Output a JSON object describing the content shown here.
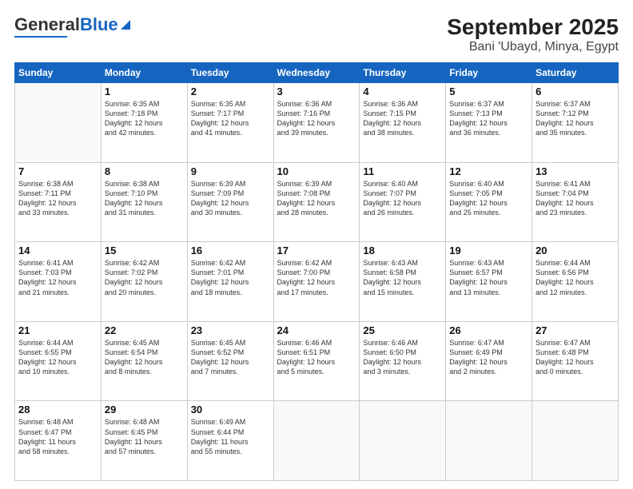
{
  "header": {
    "logo_general": "General",
    "logo_blue": "Blue",
    "month": "September 2025",
    "location": "Bani 'Ubayd, Minya, Egypt"
  },
  "days_of_week": [
    "Sunday",
    "Monday",
    "Tuesday",
    "Wednesday",
    "Thursday",
    "Friday",
    "Saturday"
  ],
  "weeks": [
    [
      {
        "day": "",
        "content": ""
      },
      {
        "day": "1",
        "content": "Sunrise: 6:35 AM\nSunset: 7:18 PM\nDaylight: 12 hours\nand 42 minutes."
      },
      {
        "day": "2",
        "content": "Sunrise: 6:35 AM\nSunset: 7:17 PM\nDaylight: 12 hours\nand 41 minutes."
      },
      {
        "day": "3",
        "content": "Sunrise: 6:36 AM\nSunset: 7:16 PM\nDaylight: 12 hours\nand 39 minutes."
      },
      {
        "day": "4",
        "content": "Sunrise: 6:36 AM\nSunset: 7:15 PM\nDaylight: 12 hours\nand 38 minutes."
      },
      {
        "day": "5",
        "content": "Sunrise: 6:37 AM\nSunset: 7:13 PM\nDaylight: 12 hours\nand 36 minutes."
      },
      {
        "day": "6",
        "content": "Sunrise: 6:37 AM\nSunset: 7:12 PM\nDaylight: 12 hours\nand 35 minutes."
      }
    ],
    [
      {
        "day": "7",
        "content": "Sunrise: 6:38 AM\nSunset: 7:11 PM\nDaylight: 12 hours\nand 33 minutes."
      },
      {
        "day": "8",
        "content": "Sunrise: 6:38 AM\nSunset: 7:10 PM\nDaylight: 12 hours\nand 31 minutes."
      },
      {
        "day": "9",
        "content": "Sunrise: 6:39 AM\nSunset: 7:09 PM\nDaylight: 12 hours\nand 30 minutes."
      },
      {
        "day": "10",
        "content": "Sunrise: 6:39 AM\nSunset: 7:08 PM\nDaylight: 12 hours\nand 28 minutes."
      },
      {
        "day": "11",
        "content": "Sunrise: 6:40 AM\nSunset: 7:07 PM\nDaylight: 12 hours\nand 26 minutes."
      },
      {
        "day": "12",
        "content": "Sunrise: 6:40 AM\nSunset: 7:05 PM\nDaylight: 12 hours\nand 25 minutes."
      },
      {
        "day": "13",
        "content": "Sunrise: 6:41 AM\nSunset: 7:04 PM\nDaylight: 12 hours\nand 23 minutes."
      }
    ],
    [
      {
        "day": "14",
        "content": "Sunrise: 6:41 AM\nSunset: 7:03 PM\nDaylight: 12 hours\nand 21 minutes."
      },
      {
        "day": "15",
        "content": "Sunrise: 6:42 AM\nSunset: 7:02 PM\nDaylight: 12 hours\nand 20 minutes."
      },
      {
        "day": "16",
        "content": "Sunrise: 6:42 AM\nSunset: 7:01 PM\nDaylight: 12 hours\nand 18 minutes."
      },
      {
        "day": "17",
        "content": "Sunrise: 6:42 AM\nSunset: 7:00 PM\nDaylight: 12 hours\nand 17 minutes."
      },
      {
        "day": "18",
        "content": "Sunrise: 6:43 AM\nSunset: 6:58 PM\nDaylight: 12 hours\nand 15 minutes."
      },
      {
        "day": "19",
        "content": "Sunrise: 6:43 AM\nSunset: 6:57 PM\nDaylight: 12 hours\nand 13 minutes."
      },
      {
        "day": "20",
        "content": "Sunrise: 6:44 AM\nSunset: 6:56 PM\nDaylight: 12 hours\nand 12 minutes."
      }
    ],
    [
      {
        "day": "21",
        "content": "Sunrise: 6:44 AM\nSunset: 6:55 PM\nDaylight: 12 hours\nand 10 minutes."
      },
      {
        "day": "22",
        "content": "Sunrise: 6:45 AM\nSunset: 6:54 PM\nDaylight: 12 hours\nand 8 minutes."
      },
      {
        "day": "23",
        "content": "Sunrise: 6:45 AM\nSunset: 6:52 PM\nDaylight: 12 hours\nand 7 minutes."
      },
      {
        "day": "24",
        "content": "Sunrise: 6:46 AM\nSunset: 6:51 PM\nDaylight: 12 hours\nand 5 minutes."
      },
      {
        "day": "25",
        "content": "Sunrise: 6:46 AM\nSunset: 6:50 PM\nDaylight: 12 hours\nand 3 minutes."
      },
      {
        "day": "26",
        "content": "Sunrise: 6:47 AM\nSunset: 6:49 PM\nDaylight: 12 hours\nand 2 minutes."
      },
      {
        "day": "27",
        "content": "Sunrise: 6:47 AM\nSunset: 6:48 PM\nDaylight: 12 hours\nand 0 minutes."
      }
    ],
    [
      {
        "day": "28",
        "content": "Sunrise: 6:48 AM\nSunset: 6:47 PM\nDaylight: 11 hours\nand 58 minutes."
      },
      {
        "day": "29",
        "content": "Sunrise: 6:48 AM\nSunset: 6:45 PM\nDaylight: 11 hours\nand 57 minutes."
      },
      {
        "day": "30",
        "content": "Sunrise: 6:49 AM\nSunset: 6:44 PM\nDaylight: 11 hours\nand 55 minutes."
      },
      {
        "day": "",
        "content": ""
      },
      {
        "day": "",
        "content": ""
      },
      {
        "day": "",
        "content": ""
      },
      {
        "day": "",
        "content": ""
      }
    ]
  ]
}
